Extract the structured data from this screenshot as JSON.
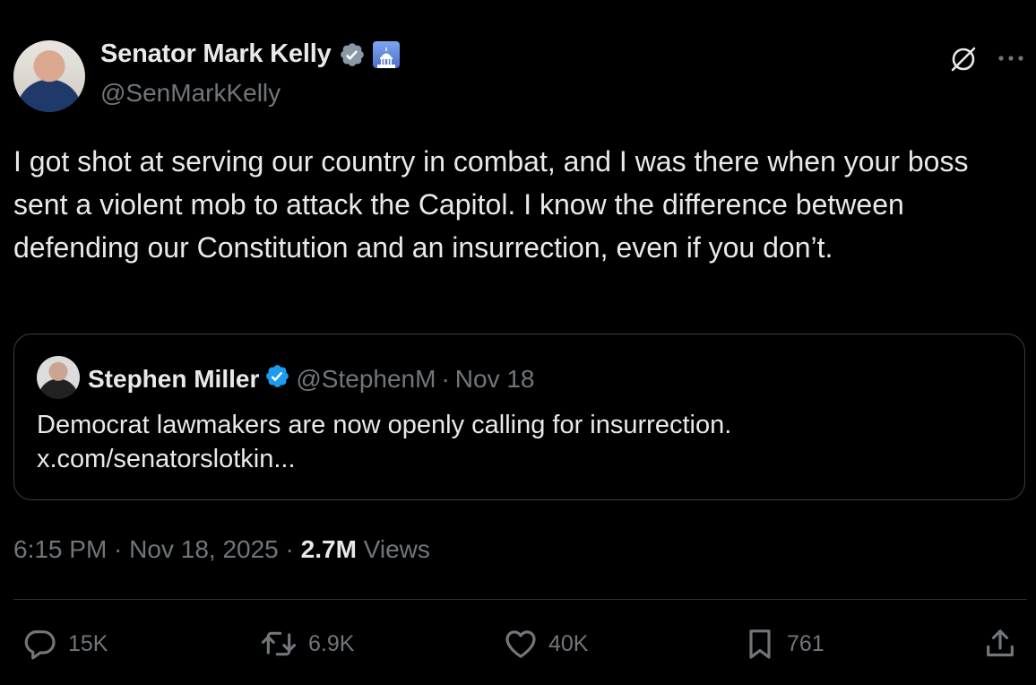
{
  "tweet": {
    "author_name": "Senator Mark Kelly",
    "handle": "@SenMarkKelly",
    "text": "I got shot at serving our country in combat, and I was there when your boss sent a violent mob to attack the Capitol. I know the difference between defending our Constitution and an insurrection, even if you don’t.",
    "time": "6:15 PM",
    "date": "Nov 18, 2025",
    "separator": " · ",
    "views_count": "2.7M",
    "views_label": "Views"
  },
  "quote": {
    "author_name": "Stephen Miller",
    "handle": "@StephenM",
    "separator": "·",
    "date": "Nov 18",
    "text": "Democrat lawmakers are now openly calling for insurrection.",
    "link": "x.com/senatorslotkin..."
  },
  "actions": {
    "replies": "15K",
    "reposts": "6.9K",
    "likes": "40K",
    "bookmarks": "761"
  },
  "icons": {
    "verified": "verified-badge-icon",
    "affiliation": "capitol-building-icon",
    "grok": "grok-icon",
    "more": "more-icon",
    "reply": "reply-icon",
    "repost": "repost-icon",
    "like": "heart-icon",
    "bookmark": "bookmark-icon",
    "share": "share-icon"
  },
  "colors": {
    "background": "#000000",
    "text": "#e7e9ea",
    "muted": "#71767b",
    "verified": "#1d9bf0",
    "border": "#2f3336"
  }
}
